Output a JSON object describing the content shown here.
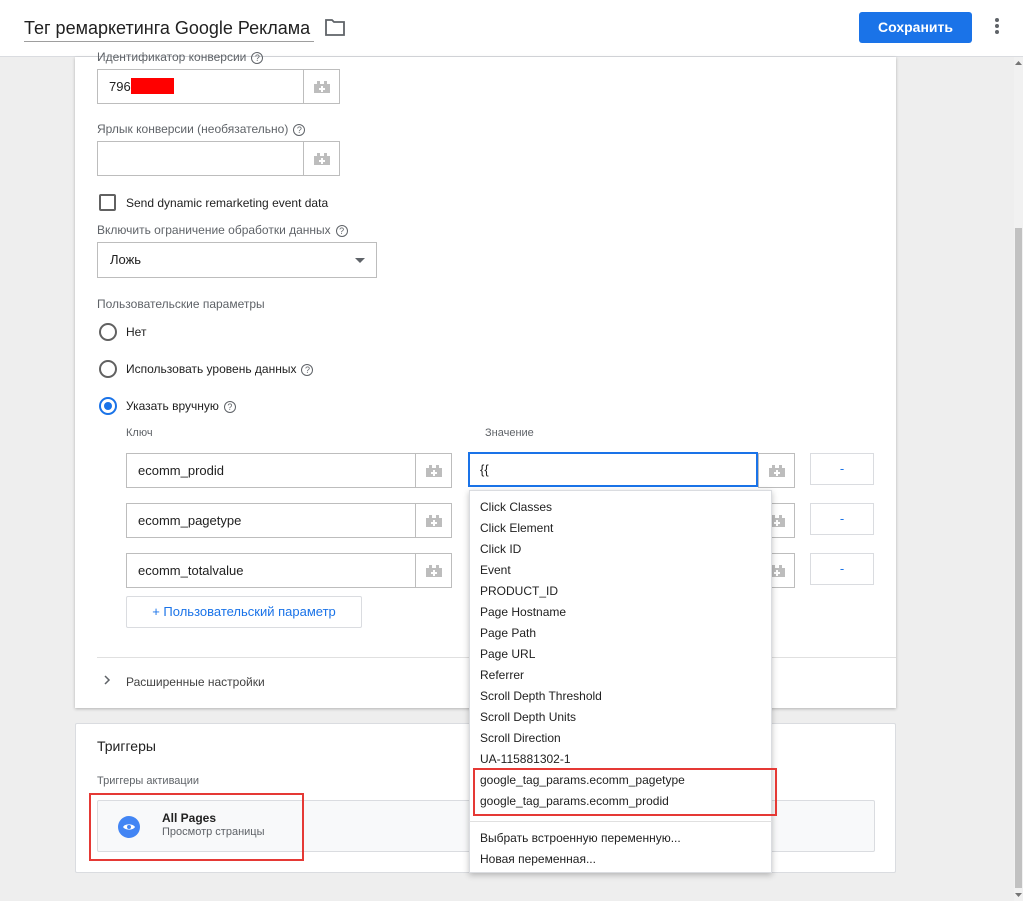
{
  "header": {
    "tag_name": "Тег ремаркетинга Google Реклама",
    "save_label": "Сохранить"
  },
  "form": {
    "conversion_id_label": "Идентификатор конверсии",
    "conversion_id_value": "796",
    "conversion_label_label": "Ярлык конверсии (необязательно)",
    "conversion_label_value": "",
    "dynamic_checkbox_label": "Send dynamic remarketing event data",
    "restrict_label": "Включить ограничение обработки данных",
    "restrict_value": "Ложь",
    "custom_params_label": "Пользовательские параметры",
    "radio_none": "Нет",
    "radio_datalayer": "Использовать уровень данных",
    "radio_manual": "Указать вручную",
    "key_header": "Ключ",
    "value_header": "Значение",
    "params": [
      {
        "key": "ecomm_prodid",
        "value": "{{"
      },
      {
        "key": "ecomm_pagetype",
        "value": ""
      },
      {
        "key": "ecomm_totalvalue",
        "value": ""
      }
    ],
    "remove_label": "-",
    "add_param_label": "+ Пользовательский параметр",
    "advanced_label": "Расширенные настройки"
  },
  "triggers": {
    "title": "Триггеры",
    "subtitle": "Триггеры активации",
    "item_name": "All Pages",
    "item_desc": "Просмотр страницы"
  },
  "dropdown": {
    "items": [
      "Click Classes",
      "Click Element",
      "Click ID",
      "Event",
      "PRODUCT_ID",
      "Page Hostname",
      "Page Path",
      "Page URL",
      "Referrer",
      "Scroll Depth Threshold",
      "Scroll Depth Units",
      "Scroll Direction",
      "UA-115881302-1",
      "google_tag_params.ecomm_pagetype",
      "google_tag_params.ecomm_prodid"
    ],
    "footer": [
      "Выбрать встроенную переменную...",
      "Новая переменная..."
    ]
  },
  "colors": {
    "accent": "#1a73e8",
    "highlight_box": "#e53935"
  }
}
